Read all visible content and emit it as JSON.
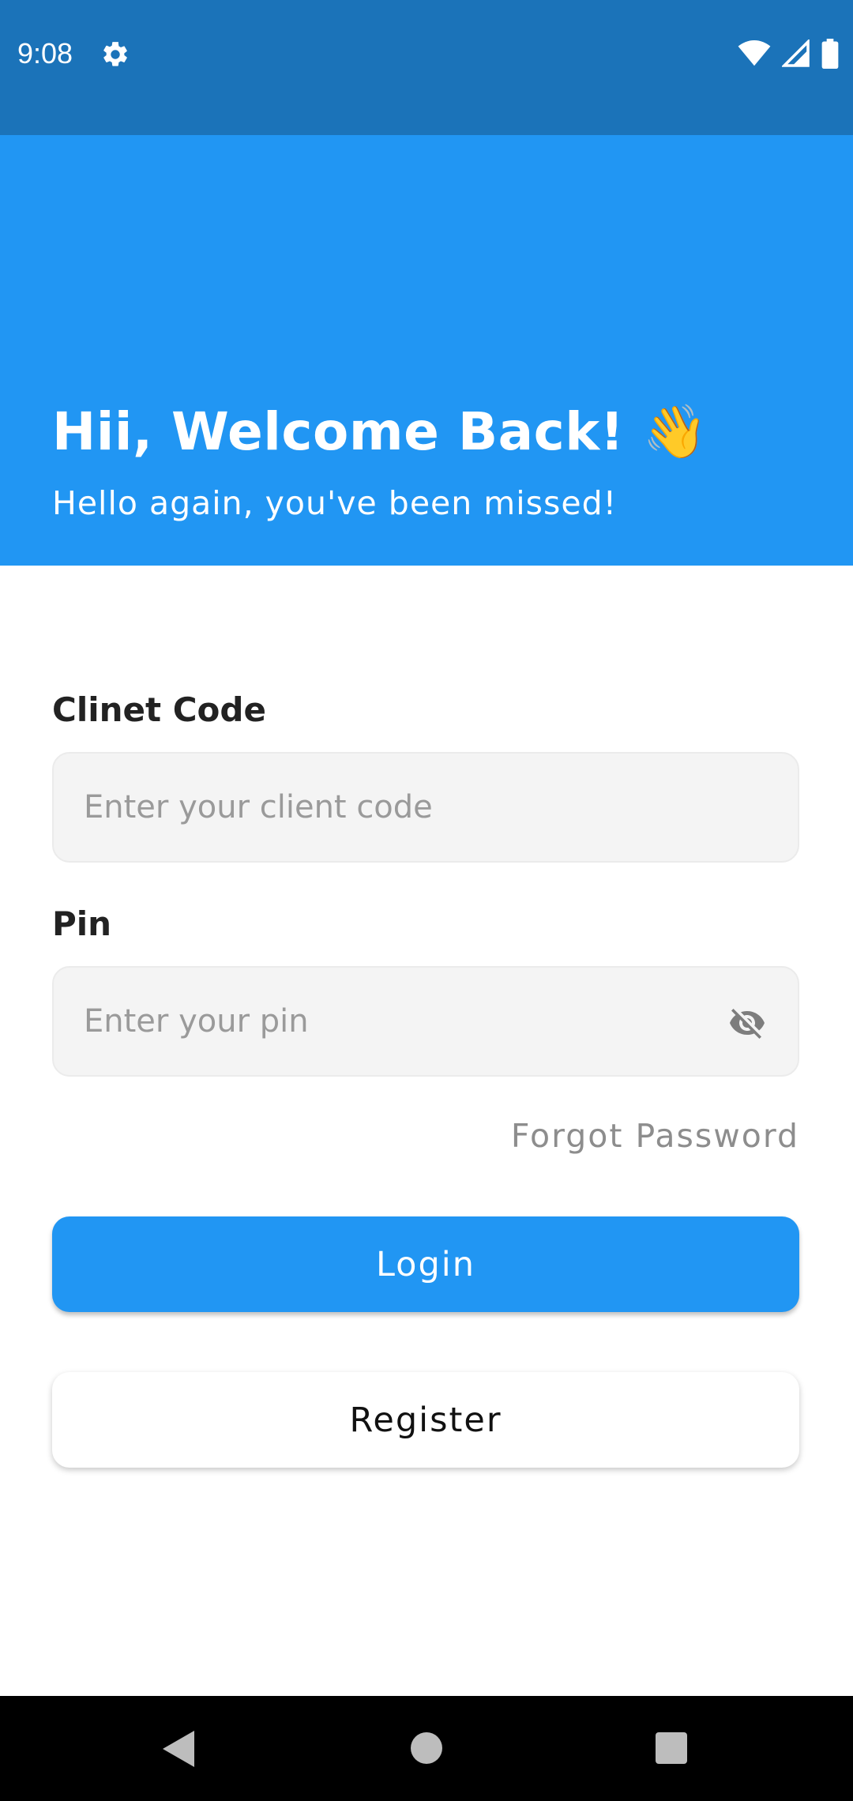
{
  "status_bar": {
    "time": "9:08",
    "icons": [
      "settings-icon",
      "wifi-icon",
      "signal-icon",
      "battery-icon"
    ],
    "background": "#1b73b9"
  },
  "header": {
    "title": "Hii, Welcome Back! 👋",
    "subtitle": "Hello again, you've been missed!",
    "background": "#2196f3"
  },
  "form": {
    "client_code": {
      "label": "Clinet Code",
      "value": "",
      "placeholder": "Enter your client code"
    },
    "pin": {
      "label": "Pin",
      "value": "",
      "placeholder": "Enter your pin",
      "toggle_icon": "eye-off-icon"
    },
    "forgot_password": "Forgot Password"
  },
  "buttons": {
    "login": "Login",
    "register": "Register"
  },
  "colors": {
    "accent": "#2196f3",
    "input_bg": "#f4f4f4",
    "muted_text": "#8d8d8d"
  },
  "nav_bar": {
    "icons": [
      "back-icon",
      "home-icon",
      "recents-icon"
    ]
  }
}
